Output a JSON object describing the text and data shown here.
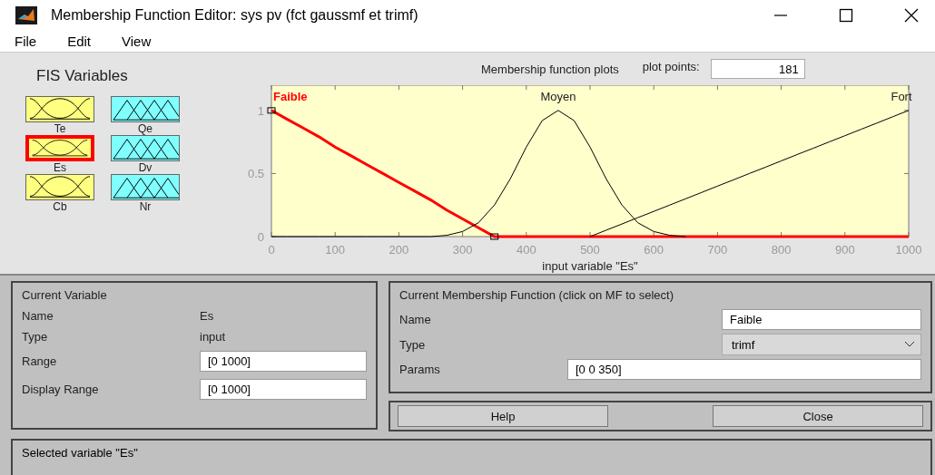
{
  "window": {
    "title": "Membership Function Editor: sys pv (fct gaussmf et trimf)"
  },
  "menu": [
    "File",
    "Edit",
    "View"
  ],
  "fis_variables": {
    "title": "FIS Variables",
    "items": [
      {
        "label": "Te",
        "kind": "input",
        "selected": false
      },
      {
        "label": "Qe",
        "kind": "output",
        "selected": false
      },
      {
        "label": "Es",
        "kind": "input",
        "selected": true
      },
      {
        "label": "Dv",
        "kind": "output",
        "selected": false
      },
      {
        "label": "Cb",
        "kind": "input",
        "selected": false
      },
      {
        "label": "Nr",
        "kind": "output",
        "selected": false
      }
    ]
  },
  "plot": {
    "title": "Membership function plots",
    "plot_points_label": "plot points:",
    "plot_points": "181",
    "chart_data": {
      "type": "line",
      "xlabel": "input variable \"Es\"",
      "xlim": [
        0,
        1000
      ],
      "ylim": [
        0,
        1.2
      ],
      "xticks": [
        0,
        100,
        200,
        300,
        400,
        500,
        600,
        700,
        800,
        900,
        1000
      ],
      "yticks": [
        0,
        0.5,
        1
      ],
      "x": [
        0,
        25,
        50,
        75,
        100,
        125,
        150,
        175,
        200,
        225,
        250,
        275,
        300,
        325,
        350,
        375,
        400,
        425,
        450,
        475,
        500,
        525,
        550,
        575,
        600,
        625,
        650,
        675,
        700,
        725,
        750,
        775,
        800,
        825,
        850,
        875,
        900,
        925,
        950,
        975,
        1000
      ],
      "series": [
        {
          "name": "Faible",
          "color": "#ff0000",
          "values": [
            1,
            0.93,
            0.86,
            0.79,
            0.71,
            0.64,
            0.57,
            0.5,
            0.43,
            0.36,
            0.29,
            0.21,
            0.14,
            0.07,
            0,
            0,
            0,
            0,
            0,
            0,
            0,
            0,
            0,
            0,
            0,
            0,
            0,
            0,
            0,
            0,
            0,
            0,
            0,
            0,
            0,
            0,
            0,
            0,
            0,
            0,
            0
          ]
        },
        {
          "name": "Moyen",
          "color": "#000000",
          "values": [
            0,
            0,
            0,
            0,
            0,
            0,
            0,
            0,
            0,
            0,
            0,
            0.01,
            0.04,
            0.11,
            0.25,
            0.46,
            0.71,
            0.92,
            1,
            0.92,
            0.71,
            0.46,
            0.25,
            0.11,
            0.04,
            0.01,
            0,
            null,
            null,
            null,
            null,
            null,
            null,
            null,
            null,
            null,
            null,
            null,
            null,
            null,
            null
          ]
        },
        {
          "name": "Fort",
          "color": "#000000",
          "values": [
            null,
            null,
            null,
            null,
            null,
            null,
            null,
            null,
            null,
            null,
            null,
            null,
            null,
            null,
            null,
            null,
            null,
            null,
            null,
            null,
            0,
            0.05,
            0.1,
            0.15,
            0.2,
            0.25,
            0.3,
            0.35,
            0.4,
            0.45,
            0.5,
            0.55,
            0.6,
            0.65,
            0.7,
            0.75,
            0.8,
            0.85,
            0.9,
            0.95,
            1
          ]
        }
      ]
    }
  },
  "mf_selection": [
    {
      "selected": true
    },
    {
      "selected": false
    },
    {
      "selected": false
    }
  ],
  "current_variable": {
    "title": "Current Variable",
    "name_label": "Name",
    "name": "Es",
    "type_label": "Type",
    "type": "input",
    "range_label": "Range",
    "range": "[0 1000]",
    "display_range_label": "Display Range",
    "display_range": "[0 1000]"
  },
  "current_mf": {
    "title": "Current Membership Function (click on MF to select)",
    "name_label": "Name",
    "name": "Faible",
    "type_label": "Type",
    "type": "trimf",
    "params_label": "Params",
    "params": "[0 0 350]"
  },
  "buttons": [
    "Help",
    "Close"
  ],
  "status_bar": "Selected variable \"Es\""
}
